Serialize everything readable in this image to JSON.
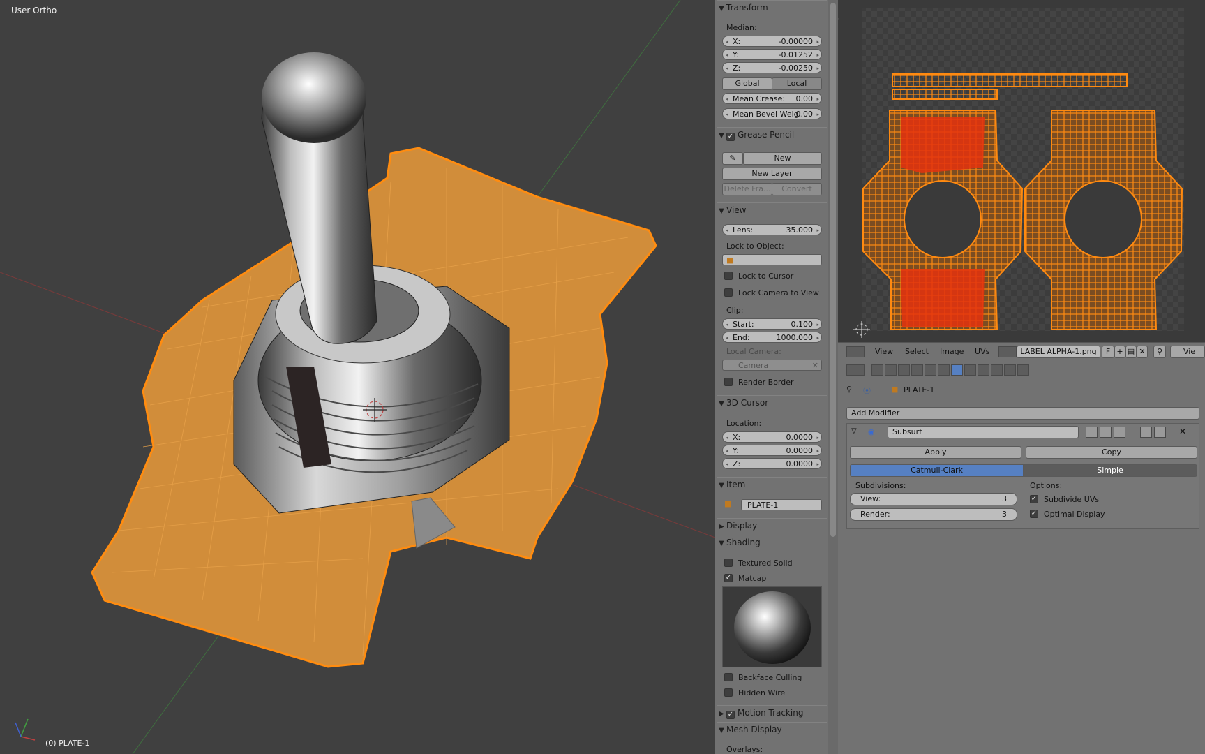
{
  "viewport": {
    "view_name": "User Ortho",
    "object_label": "(0) PLATE-1",
    "axis": {
      "x": "x",
      "y": "y",
      "z": "z"
    }
  },
  "npanel": {
    "transform": {
      "title": "Transform",
      "median_label": "Median:",
      "x": {
        "label": "X:",
        "value": "-0.00000"
      },
      "y": {
        "label": "Y:",
        "value": "-0.01252"
      },
      "z": {
        "label": "Z:",
        "value": "-0.00250"
      },
      "global_label": "Global",
      "local_label": "Local",
      "mean_crease": {
        "label": "Mean Crease:",
        "value": "0.00"
      },
      "mean_bevel": {
        "label": "Mean Bevel Weig:",
        "value": "0.00"
      }
    },
    "grease_pencil": {
      "title": "Grease Pencil",
      "new_label": "New",
      "new_layer_label": "New Layer",
      "delete_frame_label": "Delete Fra...",
      "convert_label": "Convert"
    },
    "view": {
      "title": "View",
      "lens": {
        "label": "Lens:",
        "value": "35.000"
      },
      "lock_to_object_label": "Lock to Object:",
      "lock_to_cursor_label": "Lock to Cursor",
      "lock_camera_label": "Lock Camera to View",
      "clip_label": "Clip:",
      "clip_start": {
        "label": "Start:",
        "value": "0.100"
      },
      "clip_end": {
        "label": "End:",
        "value": "1000.000"
      },
      "local_camera_label": "Local Camera:",
      "camera_placeholder": "Camera",
      "render_border_label": "Render Border"
    },
    "cursor": {
      "title": "3D Cursor",
      "location_label": "Location:",
      "x": {
        "label": "X:",
        "value": "0.0000"
      },
      "y": {
        "label": "Y:",
        "value": "0.0000"
      },
      "z": {
        "label": "Z:",
        "value": "0.0000"
      }
    },
    "item": {
      "title": "Item",
      "name": "PLATE-1"
    },
    "display": {
      "title": "Display"
    },
    "shading": {
      "title": "Shading",
      "textured_solid_label": "Textured Solid",
      "matcap_label": "Matcap",
      "backface_label": "Backface Culling",
      "hidden_wire_label": "Hidden Wire"
    },
    "motion_tracking": {
      "title": "Motion Tracking"
    },
    "mesh_display": {
      "title": "Mesh Display",
      "overlays_label": "Overlays:"
    }
  },
  "uv_header": {
    "menus": [
      "View",
      "Select",
      "Image",
      "UVs"
    ],
    "image_name": "LABEL ALPHA-1.png",
    "f_label": "F",
    "view_label": "Vie"
  },
  "properties": {
    "breadcrumb_object": "PLATE-1",
    "add_modifier_label": "Add Modifier",
    "modifier_name": "Subsurf",
    "apply_label": "Apply",
    "copy_label": "Copy",
    "catmull_label": "Catmull-Clark",
    "simple_label": "Simple",
    "subdivisions_label": "Subdivisions:",
    "view_levels": {
      "label": "View:",
      "value": "3"
    },
    "render_levels": {
      "label": "Render:",
      "value": "3"
    },
    "options_label": "Options:",
    "subdivide_uvs_label": "Subdivide UVs",
    "optimal_display_label": "Optimal Display"
  },
  "colors": {
    "selection_orange": "#f28a1a",
    "active_blue": "#5680c2",
    "panel_gray": "#727272"
  }
}
